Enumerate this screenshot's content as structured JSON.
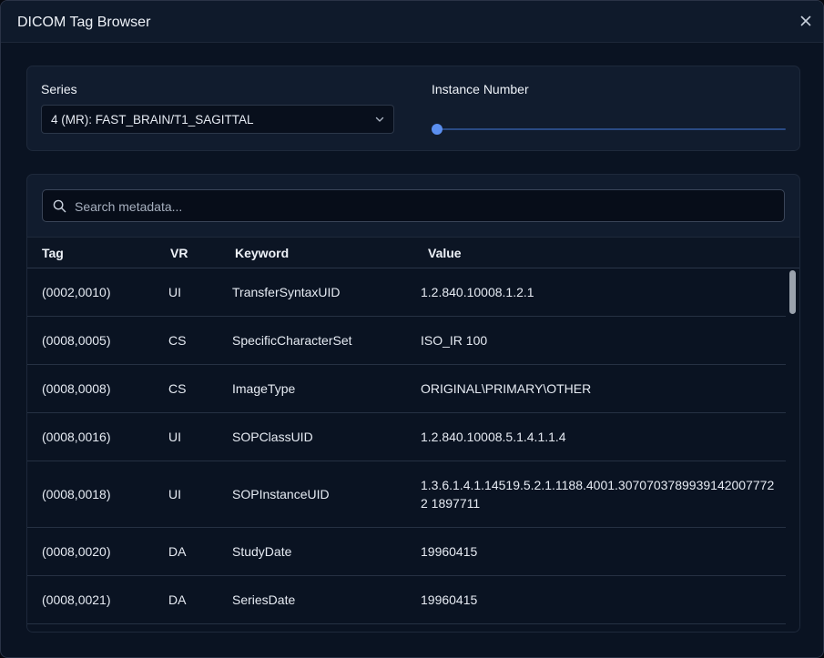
{
  "dialog": {
    "title": "DICOM Tag Browser"
  },
  "series": {
    "label": "Series",
    "selected": "4 (MR): FAST_BRAIN/T1_SAGITTAL"
  },
  "instance": {
    "label": "Instance Number",
    "slider_fraction": 0
  },
  "search": {
    "placeholder": "Search metadata..."
  },
  "table": {
    "headers": {
      "tag": "Tag",
      "vr": "VR",
      "keyword": "Keyword",
      "value": "Value"
    },
    "rows": [
      {
        "tag": "(0002,0010)",
        "vr": "UI",
        "keyword": "TransferSyntaxUID",
        "value": "1.2.840.10008.1.2.1"
      },
      {
        "tag": "(0008,0005)",
        "vr": "CS",
        "keyword": "SpecificCharacterSet",
        "value": "ISO_IR 100"
      },
      {
        "tag": "(0008,0008)",
        "vr": "CS",
        "keyword": "ImageType",
        "value": "ORIGINAL\\PRIMARY\\OTHER"
      },
      {
        "tag": "(0008,0016)",
        "vr": "UI",
        "keyword": "SOPClassUID",
        "value": "1.2.840.10008.5.1.4.1.1.4"
      },
      {
        "tag": "(0008,0018)",
        "vr": "UI",
        "keyword": "SOPInstanceUID",
        "value": "1.3.6.1.4.1.14519.5.2.1.1188.4001.30707037899391420077722 1897711"
      },
      {
        "tag": "(0008,0020)",
        "vr": "DA",
        "keyword": "StudyDate",
        "value": "19960415"
      },
      {
        "tag": "(0008,0021)",
        "vr": "DA",
        "keyword": "SeriesDate",
        "value": "19960415"
      },
      {
        "tag": "",
        "vr": "",
        "keyword": "",
        "value": ""
      }
    ]
  },
  "icons": {
    "close": "close-icon",
    "chevron": "chevron-down-icon",
    "search": "search-icon"
  },
  "colors": {
    "accent": "#5b8ff0",
    "background": "#0a1322",
    "panel": "#111c2e"
  }
}
